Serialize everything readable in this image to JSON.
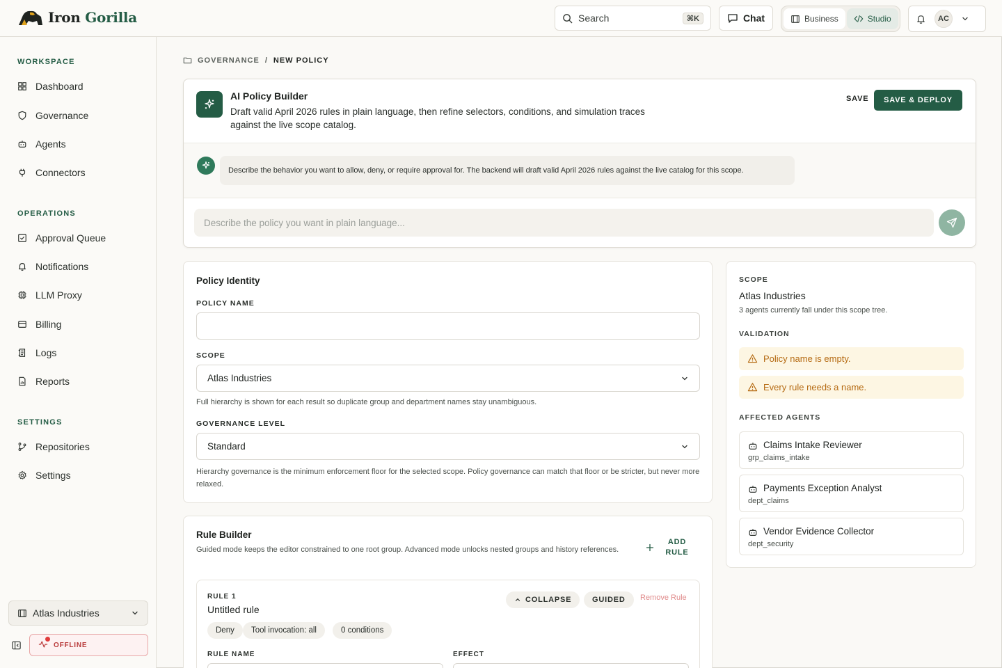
{
  "brand": {
    "name_part1": "Iron",
    "name_part2": "Gorilla"
  },
  "topbar": {
    "search_label": "Search",
    "search_shortcut": "⌘K",
    "chat_label": "Chat",
    "mode_business": "Business",
    "mode_studio": "Studio",
    "user_initials": "AC"
  },
  "sidebar": {
    "sections": [
      {
        "title": "WORKSPACE",
        "items": [
          "Dashboard",
          "Governance",
          "Agents",
          "Connectors"
        ]
      },
      {
        "title": "OPERATIONS",
        "items": [
          "Approval Queue",
          "Notifications",
          "LLM Proxy",
          "Billing",
          "Logs",
          "Reports"
        ]
      },
      {
        "title": "SETTINGS",
        "items": [
          "Repositories",
          "Settings"
        ]
      }
    ],
    "org_name": "Atlas Industries",
    "status": "OFFLINE"
  },
  "breadcrumb": {
    "parent": "GOVERNANCE",
    "separator": "/",
    "current": "NEW POLICY"
  },
  "builder": {
    "title": "AI Policy Builder",
    "description": "Draft valid April 2026 rules in plain language, then refine selectors, conditions, and simulation traces against the live scope catalog.",
    "save_label": "SAVE",
    "save_deploy_label": "SAVE & DEPLOY",
    "assistant_message": "Describe the behavior you want to allow, deny, or require approval for. The backend will draft valid April 2026 rules against the live catalog for this scope.",
    "input_placeholder": "Describe the policy you want in plain language..."
  },
  "identity": {
    "title": "Policy Identity",
    "name_label": "POLICY NAME",
    "name_value": "",
    "scope_label": "SCOPE",
    "scope_value": "Atlas Industries",
    "scope_help": "Full hierarchy is shown for each result so duplicate group and department names stay unambiguous.",
    "gov_label": "GOVERNANCE LEVEL",
    "gov_value": "Standard",
    "gov_help": "Hierarchy governance is the minimum enforcement floor for the selected scope. Policy governance can match that floor or be stricter, but never more relaxed."
  },
  "rules": {
    "title": "Rule Builder",
    "subtitle": "Guided mode keeps the editor constrained to one root group. Advanced mode unlocks nested groups and history references.",
    "add_label": "ADD RULE",
    "rule": {
      "number": "RULE 1",
      "name": "Untitled rule",
      "collapse_label": "COLLAPSE",
      "mode_label": "GUIDED",
      "remove_label": "Remove Rule",
      "pills": [
        "Deny",
        "Tool invocation: all",
        "0 conditions"
      ],
      "rule_name_label": "RULE NAME",
      "effect_label": "EFFECT"
    }
  },
  "scope_panel": {
    "scope_label": "SCOPE",
    "scope_name": "Atlas Industries",
    "scope_sub": "3 agents currently fall under this scope tree.",
    "validation_label": "VALIDATION",
    "warnings": [
      "Policy name is empty.",
      "Every rule needs a name."
    ],
    "affected_label": "AFFECTED AGENTS",
    "agents": [
      {
        "name": "Claims Intake Reviewer",
        "id": "grp_claims_intake"
      },
      {
        "name": "Payments Exception Analyst",
        "id": "dept_claims"
      },
      {
        "name": "Vendor Evidence Collector",
        "id": "dept_security"
      }
    ]
  },
  "colors": {
    "brand": "#245c45",
    "warning": "#b56a12",
    "danger": "#b83a3a"
  }
}
